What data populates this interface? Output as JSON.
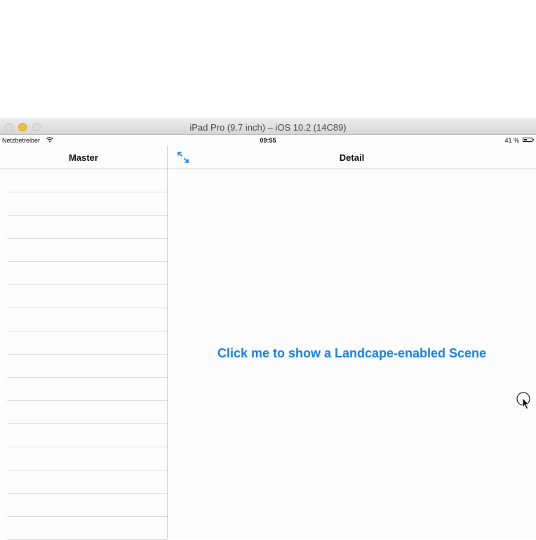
{
  "window": {
    "title": "iPad Pro (9.7 inch) – iOS 10.2 (14C89)"
  },
  "status_bar": {
    "carrier": "Netzbetreiber",
    "time": "09:55",
    "battery": "41 %",
    "battery_level": 0.41
  },
  "master": {
    "title": "Master",
    "row_count": 16
  },
  "detail": {
    "title": "Detail",
    "link_text": "Click me to show a Landcape-enabled Scene"
  },
  "colors": {
    "tint": "#1880ef"
  },
  "icons": {
    "expand": "expand-arrows-icon",
    "wifi": "wifi-icon",
    "battery": "battery-icon"
  }
}
